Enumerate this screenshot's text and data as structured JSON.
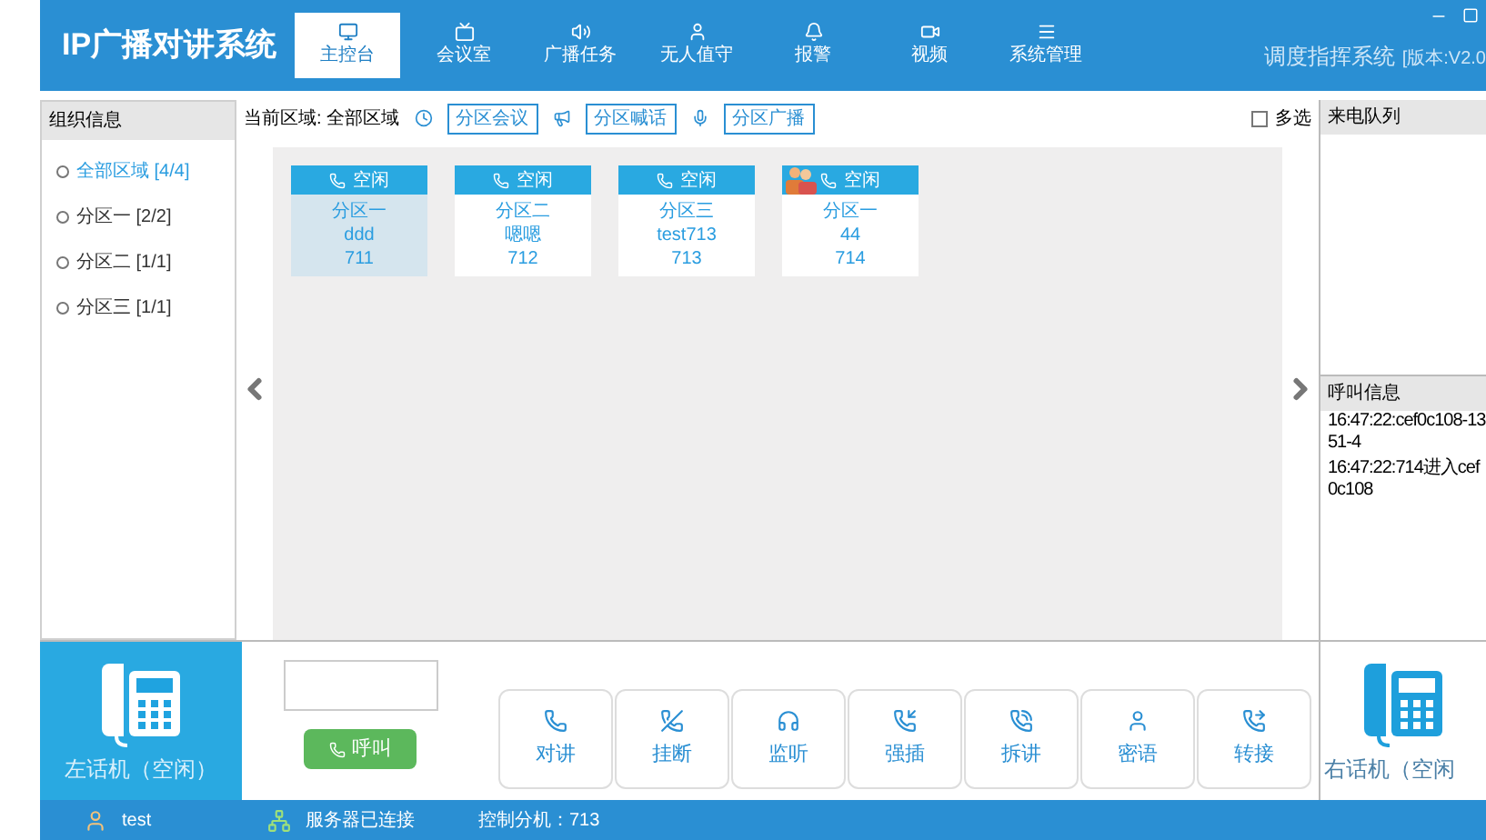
{
  "header": {
    "title": "IP广播对讲系统",
    "nav": [
      {
        "label": "主控台",
        "selected": true
      },
      {
        "label": "会议室",
        "selected": false
      },
      {
        "label": "广播任务",
        "selected": false
      },
      {
        "label": "无人值守",
        "selected": false
      },
      {
        "label": "报警",
        "selected": false
      },
      {
        "label": "视频",
        "selected": false
      },
      {
        "label": "系统管理",
        "selected": false
      }
    ],
    "subtitle": "调度指挥系统",
    "version": "[版本:V2.0"
  },
  "sidebar": {
    "title": "组织信息",
    "items": [
      {
        "label": "全部区域 [4/4]",
        "selected": true
      },
      {
        "label": "分区一 [2/2]",
        "selected": false
      },
      {
        "label": "分区二 [1/1]",
        "selected": false
      },
      {
        "label": "分区三 [1/1]",
        "selected": false
      }
    ]
  },
  "toolbar": {
    "current_area": "当前区域: 全部区域",
    "buttons": [
      "分区会议",
      "分区喊话",
      "分区广播"
    ],
    "multi_select": {
      "label": "多选",
      "checked": false
    }
  },
  "cards": [
    {
      "status": "空闲",
      "zone": "分区一",
      "name": "ddd",
      "number": "711",
      "selected": true,
      "avatar": false
    },
    {
      "status": "空闲",
      "zone": "分区二",
      "name": "嗯嗯",
      "number": "712",
      "selected": false,
      "avatar": false
    },
    {
      "status": "空闲",
      "zone": "分区三",
      "name": "test713",
      "number": "713",
      "selected": false,
      "avatar": false
    },
    {
      "status": "空闲",
      "zone": "分区一",
      "name": "44",
      "number": "714",
      "selected": false,
      "avatar": true
    }
  ],
  "right_panel": {
    "queue_title": "来电队列",
    "info_title": "呼叫信息",
    "info_lines": [
      "16:47:22:cef0c108-1351-4",
      "16:47:22:714进入cef0c108"
    ]
  },
  "left_phone": "左话机（空闲）",
  "call_button": "呼叫",
  "actions": [
    "对讲",
    "挂断",
    "监听",
    "强插",
    "拆讲",
    "密语",
    "转接"
  ],
  "right_phone": "右话机（空闲",
  "status_bar": {
    "user": "test",
    "server": "服务器已连接",
    "extension": "控制分机：713"
  }
}
